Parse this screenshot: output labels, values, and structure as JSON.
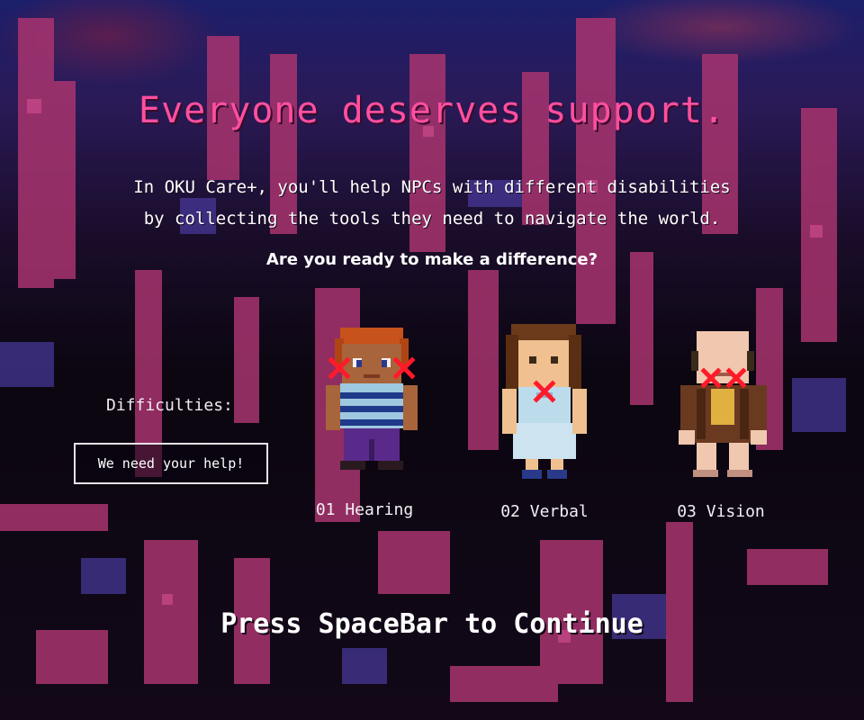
{
  "screen": {
    "title": "Everyone deserves support.",
    "intro_line1": "In OKU Care+, you'll help NPCs with different disabilities",
    "intro_line2": "by collecting the tools they need to navigate the world.",
    "question": "Are you ready to make a difference?",
    "continue_prompt": "Press SpaceBar to Continue"
  },
  "difficulties": {
    "label": "Difficulties:",
    "button_label": "We need your help!"
  },
  "npcs": [
    {
      "label": "01 Hearing",
      "icon": "red-x-ears"
    },
    {
      "label": "02 Verbal",
      "icon": "red-x-mouth"
    },
    {
      "label": "03 Vision",
      "icon": "red-x-eyes"
    }
  ],
  "colors": {
    "title": "#ff4fa0",
    "x_mark": "#ff1a2a",
    "bg_pink": "#a8346f",
    "bg_blue": "#1c1f6b"
  }
}
